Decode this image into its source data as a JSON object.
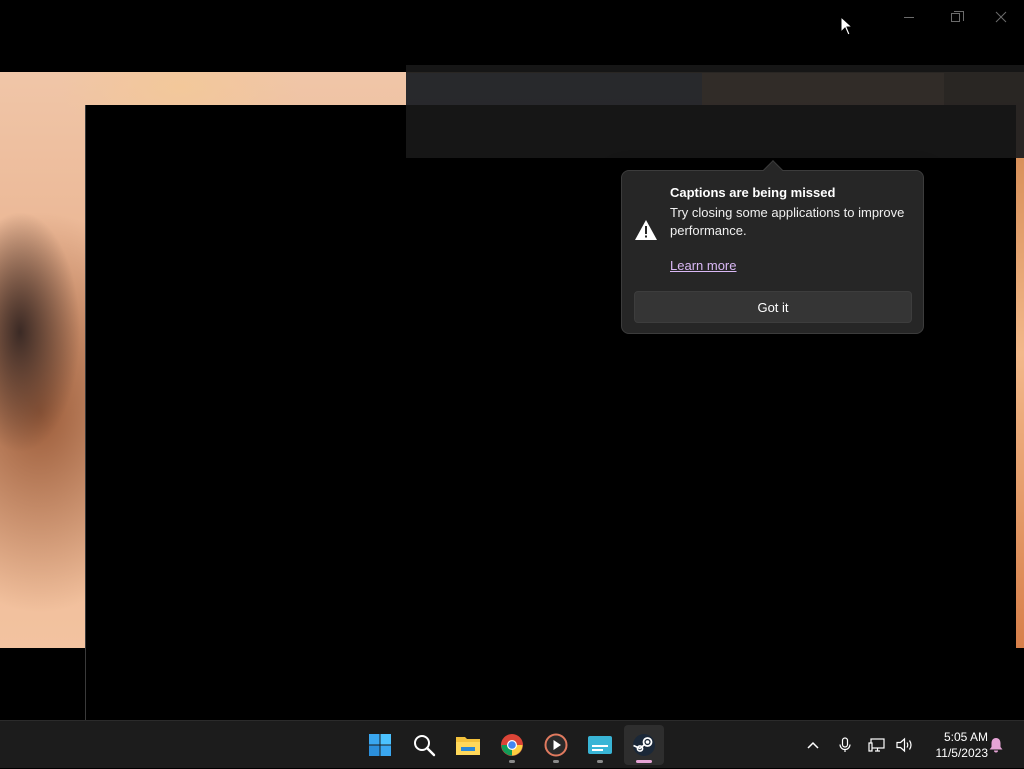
{
  "window": {
    "controls": [
      "minimize",
      "maximize",
      "close"
    ]
  },
  "teaching_tip": {
    "icon": "warning-icon",
    "title": "Captions are being missed",
    "body": "Try closing some applications to improve performance.",
    "link": "Learn more",
    "button": "Got it"
  },
  "taskbar": {
    "apps": [
      {
        "name": "start",
        "icon": "windows-start-icon",
        "running": false,
        "active": false
      },
      {
        "name": "search",
        "icon": "search-icon",
        "running": false,
        "active": false
      },
      {
        "name": "file-explorer",
        "icon": "folder-icon",
        "running": false,
        "active": false
      },
      {
        "name": "chrome",
        "icon": "chrome-icon",
        "running": true,
        "active": false
      },
      {
        "name": "media-player",
        "icon": "play-icon",
        "running": true,
        "active": false
      },
      {
        "name": "live-captions",
        "icon": "captions-icon",
        "running": true,
        "active": false
      },
      {
        "name": "steam",
        "icon": "steam-icon",
        "running": true,
        "active": true
      }
    ],
    "tray": [
      "chevron-up-icon",
      "microphone-icon",
      "network-icon",
      "volume-icon"
    ],
    "clock": {
      "time": "5:05 AM",
      "date": "11/5/2023"
    },
    "notification_icon": "bell-icon"
  },
  "colors": {
    "accent_link": "#d9b8f5",
    "active_indicator": "#e6a4d6",
    "taskbar_bg": "#1c1c1c",
    "tip_bg": "#262626"
  }
}
